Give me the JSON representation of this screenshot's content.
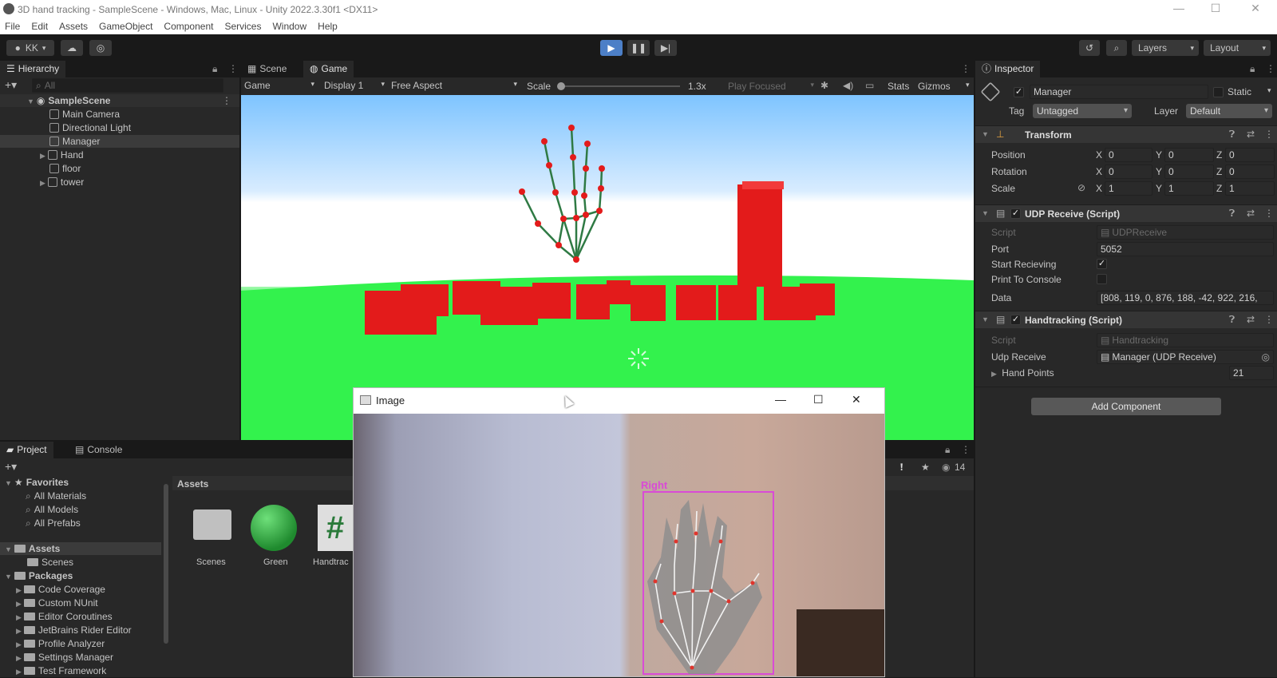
{
  "window": {
    "title": "3D hand tracking - SampleScene - Windows, Mac, Linux - Unity 2022.3.30f1 <DX11>"
  },
  "menu": [
    "File",
    "Edit",
    "Assets",
    "GameObject",
    "Component",
    "Services",
    "Window",
    "Help"
  ],
  "toolbar": {
    "account": "KK",
    "layers": "Layers",
    "layout": "Layout"
  },
  "hierarchy": {
    "tab": "Hierarchy",
    "search_placeholder": "All",
    "scene": "SampleScene",
    "items": [
      "Main Camera",
      "Directional Light",
      "Manager",
      "Hand",
      "floor",
      "tower"
    ]
  },
  "scene_tabs": {
    "scene": "Scene",
    "game": "Game"
  },
  "game_toolbar": {
    "mode": "Game",
    "display": "Display 1",
    "aspect": "Free Aspect",
    "scale_label": "Scale",
    "scale_value": "1.3x",
    "play_focused": "Play Focused",
    "stats": "Stats",
    "gizmos": "Gizmos"
  },
  "inspector": {
    "tab": "Inspector",
    "object_name": "Manager",
    "static": "Static",
    "tag_label": "Tag",
    "tag_value": "Untagged",
    "layer_label": "Layer",
    "layer_value": "Default",
    "transform": {
      "title": "Transform",
      "position_label": "Position",
      "rotation_label": "Rotation",
      "scale_label": "Scale",
      "position": {
        "x": "0",
        "y": "0",
        "z": "0"
      },
      "rotation": {
        "x": "0",
        "y": "0",
        "z": "0"
      },
      "scale": {
        "x": "1",
        "y": "1",
        "z": "1"
      }
    },
    "udp": {
      "title": "UDP Receive (Script)",
      "script_label": "Script",
      "script_value": "UDPReceive",
      "port_label": "Port",
      "port_value": "5052",
      "start_label": "Start Recieving",
      "print_label": "Print To Console",
      "data_label": "Data",
      "data_value": "[808, 119, 0, 876, 188, -42, 922, 216,"
    },
    "hand": {
      "title": "Handtracking (Script)",
      "script_label": "Script",
      "script_value": "Handtracking",
      "udp_label": "Udp Receive",
      "udp_value": "Manager (UDP Receive)",
      "points_label": "Hand Points",
      "points_value": "21"
    },
    "add_component": "Add Component"
  },
  "project": {
    "tab_project": "Project",
    "tab_console": "Console",
    "favorites": "Favorites",
    "fav_items": [
      "All Materials",
      "All Models",
      "All Prefabs"
    ],
    "assets": "Assets",
    "assets_items": [
      "Scenes"
    ],
    "packages": "Packages",
    "package_items": [
      "Code Coverage",
      "Custom NUnit",
      "Editor Coroutines",
      "JetBrains Rider Editor",
      "Profile Analyzer",
      "Settings Manager",
      "Test Framework"
    ],
    "breadcrumb": "Assets",
    "asset_tiles": [
      "Scenes",
      "Green",
      "Handtrac"
    ],
    "badge_count": "14"
  },
  "image_window": {
    "title": "Image",
    "hand_label": "Right"
  },
  "colors": {
    "cube_red": "#e31b1b",
    "floor_green": "#33f24d",
    "play_blue": "#4c7fc7",
    "bbox_magenta": "#d94bd6"
  }
}
